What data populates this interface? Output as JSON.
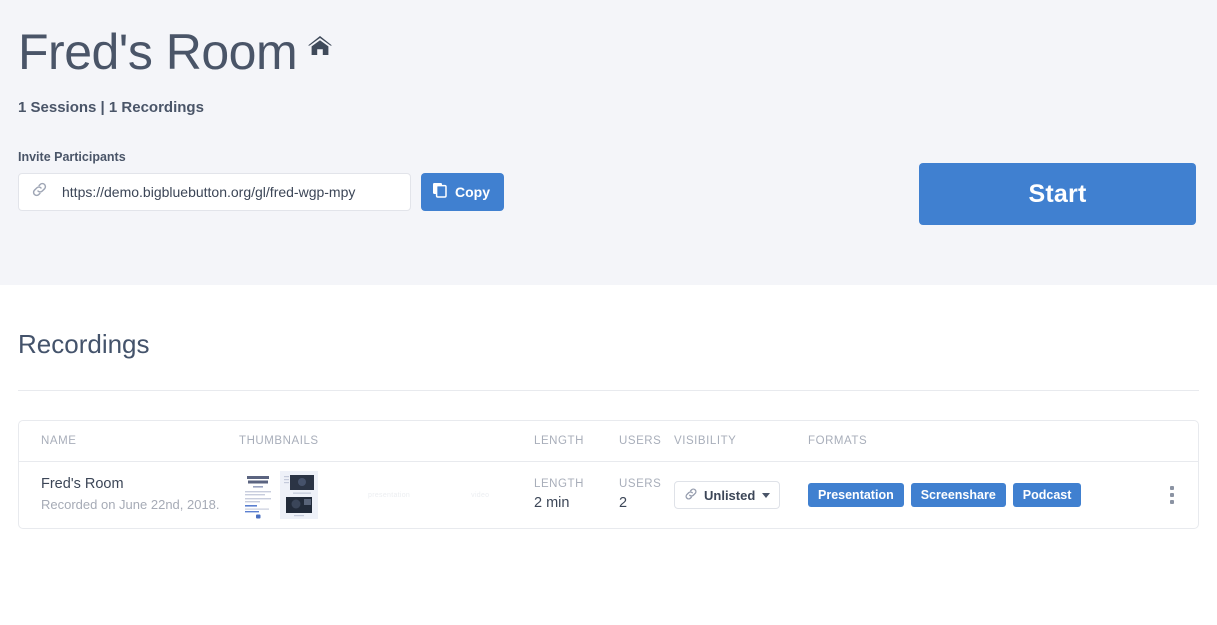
{
  "hero": {
    "title": "Fred's Room",
    "home_icon": "home-icon",
    "counts": "1 Sessions | 1 Recordings",
    "invite_label": "Invite Participants",
    "invite_url": "https://demo.bigbluebutton.org/gl/fred-wgp-mpy",
    "link_icon": "chain-link-icon",
    "copy_label": "Copy",
    "copy_icon": "copy-icon",
    "start_label": "Start",
    "accent_color": "#4080d0",
    "banner_color": "#f4f5f9"
  },
  "recordings": {
    "heading": "Recordings",
    "columns": [
      "NAME",
      "THUMBNAILS",
      "LENGTH",
      "USERS",
      "VISIBILITY",
      "FORMATS"
    ],
    "rows": [
      {
        "name": "Fred's Room",
        "date": "Recorded on June 22nd, 2018.",
        "thumb_placeholder_1": "presentation",
        "thumb_placeholder_2": "video",
        "length_label": "LENGTH",
        "length": "2 min",
        "users_label": "USERS",
        "users": "2",
        "visibility": "Unlisted",
        "visibility_icon": "chain-link-icon",
        "formats": [
          "Presentation",
          "Screenshare",
          "Podcast"
        ],
        "menu_icon": "kebab-menu-icon"
      }
    ]
  }
}
